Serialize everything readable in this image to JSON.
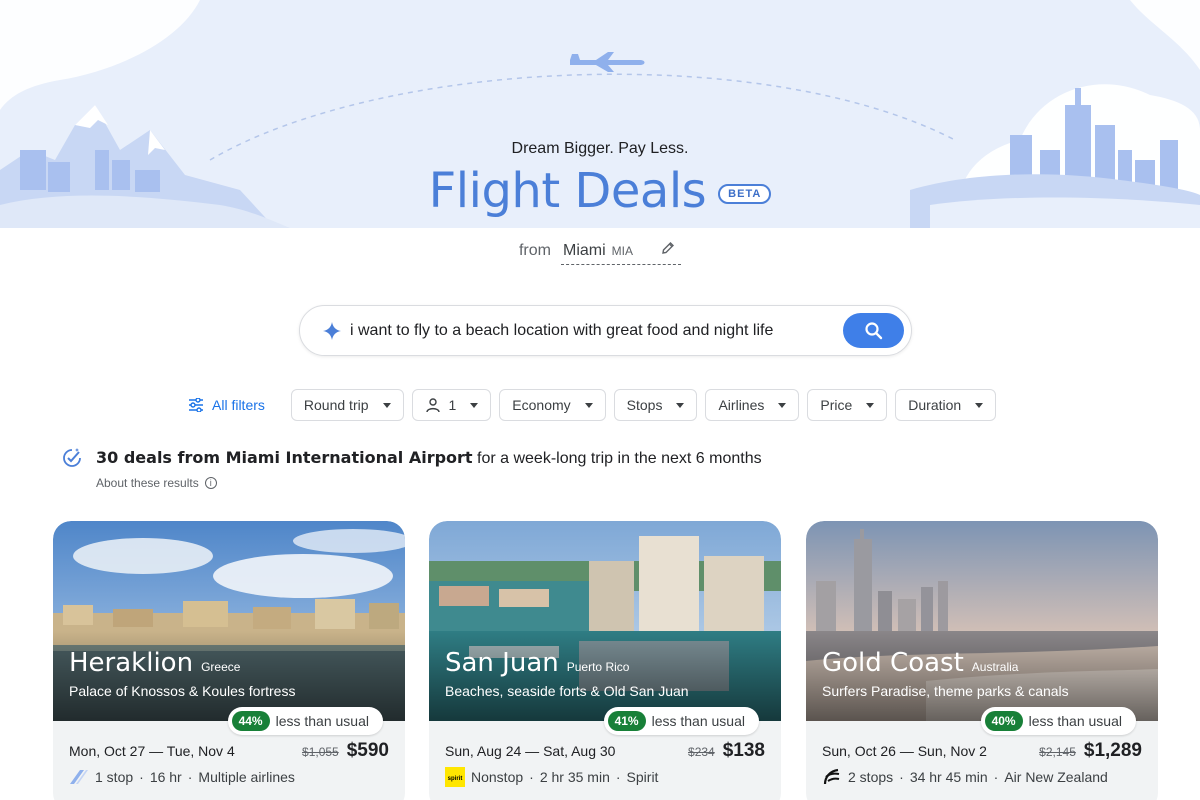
{
  "hero": {
    "tagline": "Dream Bigger. Pay Less.",
    "title": "Flight Deals",
    "beta_label": "BETA",
    "origin_prefix": "from",
    "origin_city": "Miami",
    "origin_code": "MIA",
    "edit_icon": "pencil-icon"
  },
  "search": {
    "icon": "sparkle-icon",
    "value": "i want to fly to a beach location with great food and night life",
    "button_icon": "search-icon"
  },
  "filters": {
    "all_filters_label": "All filters",
    "trip_type": "Round trip",
    "passengers": "1",
    "cabin": "Economy",
    "stops": "Stops",
    "airlines": "Airlines",
    "price": "Price",
    "duration": "Duration"
  },
  "results": {
    "count_bold": "30 deals from Miami International Airport",
    "count_rest": " for a week-long trip in the next 6 months",
    "about_label": "About these results"
  },
  "colors": {
    "accent": "#4b7fd8",
    "search_button": "#3f7fe8",
    "deal_green": "#188038"
  },
  "deals": [
    {
      "city": "Heraklion",
      "country": "Greece",
      "tagline": "Palace of Knossos & Koules fortress",
      "discount": "44%",
      "discount_text": "less than usual",
      "dates": "Mon, Oct 27 — Tue, Nov 4",
      "old_price": "$1,055",
      "price": "$590",
      "stops": "1 stop",
      "duration": "16 hr",
      "airline": "Multiple airlines",
      "airline_icon": "multiple-airlines-icon"
    },
    {
      "city": "San Juan",
      "country": "Puerto Rico",
      "tagline": "Beaches, seaside forts & Old San Juan",
      "discount": "41%",
      "discount_text": "less than usual",
      "dates": "Sun, Aug 24 — Sat, Aug 30",
      "old_price": "$234",
      "price": "$138",
      "stops": "Nonstop",
      "duration": "2 hr 35 min",
      "airline": "Spirit",
      "airline_icon": "spirit-logo-icon",
      "airline_logo_text": "spirit"
    },
    {
      "city": "Gold Coast",
      "country": "Australia",
      "tagline": "Surfers Paradise, theme parks & canals",
      "discount": "40%",
      "discount_text": "less than usual",
      "dates": "Sun, Oct 26 — Sun, Nov 2",
      "old_price": "$2,145",
      "price": "$1,289",
      "stops": "2 stops",
      "duration": "34 hr 45 min",
      "airline": "Air New Zealand",
      "airline_icon": "air-new-zealand-logo-icon"
    }
  ],
  "separator": "·"
}
